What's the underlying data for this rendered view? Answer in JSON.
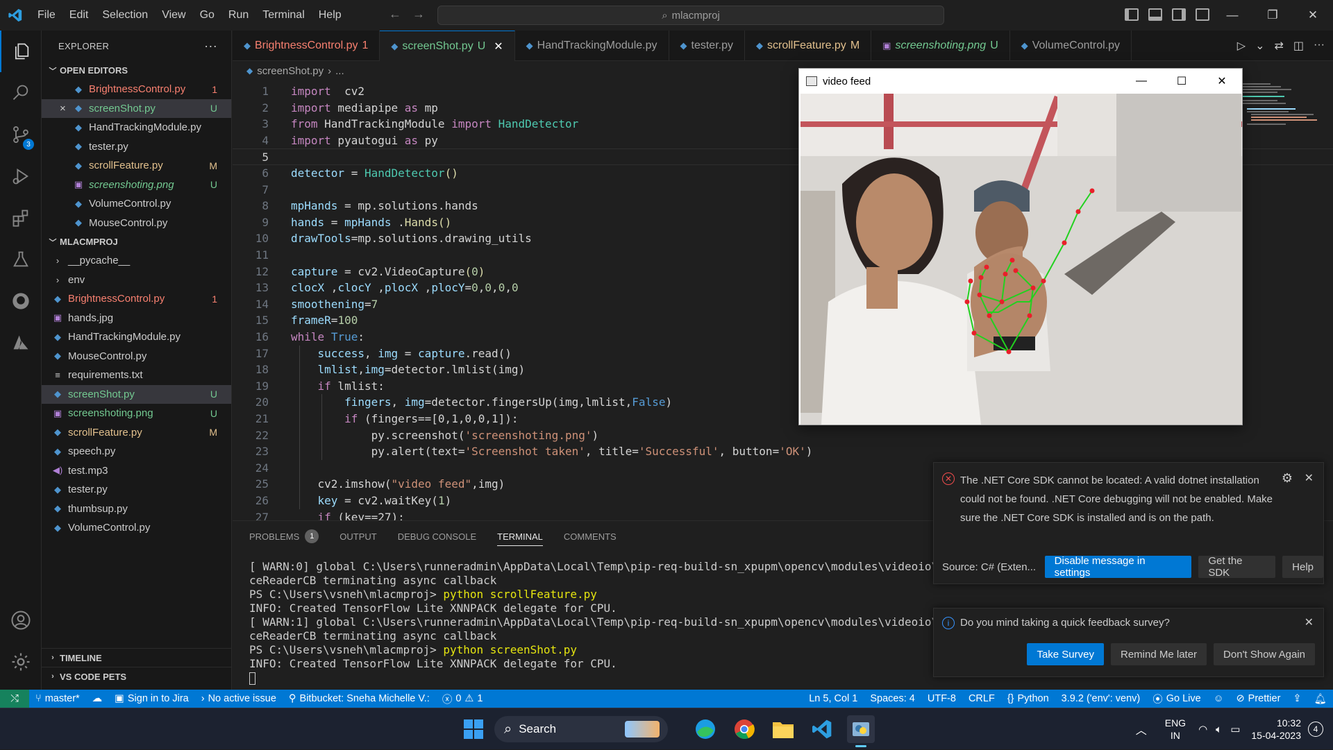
{
  "titlebar": {
    "menu": [
      "File",
      "Edit",
      "Selection",
      "View",
      "Go",
      "Run",
      "Terminal",
      "Help"
    ],
    "search": "mlacmproj"
  },
  "explorer": {
    "title": "EXPLORER",
    "open_editors_label": "OPEN EDITORS",
    "open_editors": [
      {
        "name": "BrightnessControl.py",
        "badge": "1",
        "status": "error",
        "icon": "python-icon"
      },
      {
        "name": "screenShot.py",
        "badge": "U",
        "status": "untracked",
        "icon": "python-icon",
        "selected": true,
        "close": "×"
      },
      {
        "name": "HandTrackingModule.py",
        "badge": "",
        "status": "",
        "icon": "python-icon"
      },
      {
        "name": "tester.py",
        "badge": "",
        "status": "",
        "icon": "python-icon"
      },
      {
        "name": "scrollFeature.py",
        "badge": "M",
        "status": "modified",
        "icon": "python-icon"
      },
      {
        "name": "screenshoting.png",
        "badge": "U",
        "status": "untracked-italic",
        "icon": "image-icon"
      },
      {
        "name": "VolumeControl.py",
        "badge": "",
        "status": "",
        "icon": "python-icon"
      },
      {
        "name": "MouseControl.py",
        "badge": "",
        "status": "",
        "icon": "python-icon"
      }
    ],
    "project_label": "MLACMPROJ",
    "files": [
      {
        "name": "__pycache__",
        "badge": "",
        "status": "",
        "icon": "chevron-right-icon",
        "folder": true
      },
      {
        "name": "env",
        "badge": "",
        "status": "",
        "icon": "chevron-right-icon",
        "folder": true
      },
      {
        "name": "BrightnessControl.py",
        "badge": "1",
        "status": "error",
        "icon": "python-icon"
      },
      {
        "name": "hands.jpg",
        "badge": "",
        "status": "",
        "icon": "image-icon"
      },
      {
        "name": "HandTrackingModule.py",
        "badge": "",
        "status": "",
        "icon": "python-icon"
      },
      {
        "name": "MouseControl.py",
        "badge": "",
        "status": "",
        "icon": "python-icon"
      },
      {
        "name": "requirements.txt",
        "badge": "",
        "status": "",
        "icon": "text-file-icon"
      },
      {
        "name": "screenShot.py",
        "badge": "U",
        "status": "untracked",
        "icon": "python-icon",
        "selected": true
      },
      {
        "name": "screenshoting.png",
        "badge": "U",
        "status": "untracked",
        "icon": "image-icon"
      },
      {
        "name": "scrollFeature.py",
        "badge": "M",
        "status": "modified",
        "icon": "python-icon"
      },
      {
        "name": "speech.py",
        "badge": "",
        "status": "",
        "icon": "python-icon"
      },
      {
        "name": "test.mp3",
        "badge": "",
        "status": "",
        "icon": "audio-icon"
      },
      {
        "name": "tester.py",
        "badge": "",
        "status": "",
        "icon": "python-icon"
      },
      {
        "name": "thumbsup.py",
        "badge": "",
        "status": "",
        "icon": "python-icon"
      },
      {
        "name": "VolumeControl.py",
        "badge": "",
        "status": "",
        "icon": "python-icon"
      }
    ],
    "timeline_label": "TIMELINE",
    "pets_label": "VS CODE PETS"
  },
  "tabs": [
    {
      "label": "BrightnessControl.py",
      "suffix": "1",
      "color": "#f88070"
    },
    {
      "label": "screenShot.py",
      "suffix": "U",
      "color": "#73c991",
      "active": true
    },
    {
      "label": "HandTrackingModule.py",
      "suffix": "",
      "color": ""
    },
    {
      "label": "tester.py",
      "suffix": "",
      "color": ""
    },
    {
      "label": "scrollFeature.py",
      "suffix": "M",
      "color": "#e2c08d"
    },
    {
      "label": "screenshoting.png",
      "suffix": "U",
      "color": "#73c991",
      "italic": true
    },
    {
      "label": "VolumeControl.py",
      "suffix": "",
      "color": ""
    }
  ],
  "breadcrumb": {
    "file": "screenShot.py",
    "rest": "..."
  },
  "editor": {
    "current_line": 5,
    "lines": [
      [
        [
          "kw",
          "import"
        ],
        [
          "",
          "  cv2"
        ]
      ],
      [
        [
          "kw",
          "import"
        ],
        [
          "",
          " mediapipe "
        ],
        [
          "kw",
          "as"
        ],
        [
          "",
          " mp"
        ]
      ],
      [
        [
          "kw",
          "from"
        ],
        [
          "",
          " HandTrackingModule "
        ],
        [
          "kw",
          "import"
        ],
        [
          "",
          " "
        ],
        [
          "cls",
          "HandDetector"
        ]
      ],
      [
        [
          "kw",
          "import"
        ],
        [
          "",
          " pyautogui "
        ],
        [
          "kw",
          "as"
        ],
        [
          "",
          " py"
        ]
      ],
      [],
      [
        [
          "var",
          "detector"
        ],
        [
          "",
          " = "
        ],
        [
          "cls",
          "HandDetector"
        ],
        [
          "fn",
          "()"
        ]
      ],
      [],
      [
        [
          "var",
          "mpHands"
        ],
        [
          "",
          " = mp.solutions.hands"
        ]
      ],
      [
        [
          "var",
          "hands"
        ],
        [
          "",
          " = "
        ],
        [
          "var",
          "mpHands"
        ],
        [
          "",
          " ."
        ],
        [
          "fn",
          "Hands"
        ],
        [
          "fn",
          "()"
        ]
      ],
      [
        [
          "var",
          "drawTools"
        ],
        [
          "",
          "=mp.solutions.drawing_utils"
        ]
      ],
      [],
      [
        [
          "var",
          "capture"
        ],
        [
          "",
          " = cv2.VideoCapture"
        ],
        [
          "fn",
          "("
        ],
        [
          "num",
          "0"
        ],
        [
          "fn",
          ")"
        ]
      ],
      [
        [
          "var",
          "clocX"
        ],
        [
          "",
          " ,"
        ],
        [
          "var",
          "clocY"
        ],
        [
          "",
          " ,"
        ],
        [
          "var",
          "plocX"
        ],
        [
          "",
          " ,"
        ],
        [
          "var",
          "plocY"
        ],
        [
          "",
          "="
        ],
        [
          "num",
          "0"
        ],
        [
          "",
          ","
        ],
        [
          "num",
          "0"
        ],
        [
          "",
          ","
        ],
        [
          "num",
          "0"
        ],
        [
          "",
          ","
        ],
        [
          "num",
          "0"
        ]
      ],
      [
        [
          "var",
          "smoothening"
        ],
        [
          "",
          "="
        ],
        [
          "num",
          "7"
        ]
      ],
      [
        [
          "var",
          "frameR"
        ],
        [
          "",
          "="
        ],
        [
          "num",
          "100"
        ]
      ],
      [
        [
          "kw",
          "while"
        ],
        [
          "",
          " "
        ],
        [
          "bl",
          "True"
        ],
        [
          "",
          ":"
        ]
      ],
      [
        [
          "",
          "    "
        ],
        [
          "var",
          "success"
        ],
        [
          "",
          ", "
        ],
        [
          "var",
          "img"
        ],
        [
          "",
          " = "
        ],
        [
          "var",
          "capture"
        ],
        [
          "",
          ".read()"
        ]
      ],
      [
        [
          "",
          "    "
        ],
        [
          "var",
          "lmlist"
        ],
        [
          "",
          ","
        ],
        [
          "var",
          "img"
        ],
        [
          "",
          "=detector.lmlist(img)"
        ]
      ],
      [
        [
          "",
          "    "
        ],
        [
          "kw",
          "if"
        ],
        [
          "",
          " lmlist:"
        ]
      ],
      [
        [
          "",
          "        "
        ],
        [
          "var",
          "fingers"
        ],
        [
          "",
          ", "
        ],
        [
          "var",
          "img"
        ],
        [
          "",
          "=detector.fingersUp(img,lmlist,"
        ],
        [
          "bl",
          "False"
        ],
        [
          "",
          ")"
        ]
      ],
      [
        [
          "",
          "        "
        ],
        [
          "kw",
          "if"
        ],
        [
          "",
          " (fingers==[0,1,0,0,1]):"
        ]
      ],
      [
        [
          "",
          "            py.screenshot("
        ],
        [
          "str",
          "'screenshoting.png'"
        ],
        [
          "",
          ")"
        ]
      ],
      [
        [
          "",
          "            py.alert(text="
        ],
        [
          "str",
          "'Screenshot taken'"
        ],
        [
          "",
          ", title="
        ],
        [
          "str",
          "'Successful'"
        ],
        [
          "",
          ", button="
        ],
        [
          "str",
          "'OK'"
        ],
        [
          "",
          ")"
        ]
      ],
      [],
      [
        [
          "",
          "    cv2.imshow("
        ],
        [
          "str",
          "\"video feed\""
        ],
        [
          "",
          ",img)"
        ]
      ],
      [
        [
          "",
          "    "
        ],
        [
          "var",
          "key"
        ],
        [
          "",
          " = cv2.waitKey("
        ],
        [
          "num",
          "1"
        ],
        [
          "",
          ")"
        ]
      ],
      [
        [
          "",
          "    "
        ],
        [
          "kw",
          "if"
        ],
        [
          "",
          " (key==27):"
        ]
      ]
    ]
  },
  "video_window": {
    "title": "video feed"
  },
  "panel": {
    "tabs": [
      "PROBLEMS",
      "OUTPUT",
      "DEBUG CONSOLE",
      "TERMINAL",
      "COMMENTS"
    ],
    "problems_count": "1",
    "active_tab": "TERMINAL",
    "terminal_lines": [
      {
        "text": "[ WARN:0] global C:\\Users\\runneradmin\\AppData\\Local\\Temp\\pip-req-build-sn_xpupm\\opencv\\modules\\videoio\\src\\cap",
        "cmd": ""
      },
      {
        "text": "ceReaderCB terminating async callback",
        "cmd": ""
      },
      {
        "text": "PS C:\\Users\\vsneh\\mlacmproj> ",
        "cmd": "python scrollFeature.py"
      },
      {
        "text": "INFO: Created TensorFlow Lite XNNPACK delegate for CPU.",
        "cmd": ""
      },
      {
        "text": "[ WARN:1] global C:\\Users\\runneradmin\\AppData\\Local\\Temp\\pip-req-build-sn_xpupm\\opencv\\modules\\videoio\\src\\cap",
        "cmd": ""
      },
      {
        "text": "ceReaderCB terminating async callback",
        "cmd": ""
      },
      {
        "text": "PS C:\\Users\\vsneh\\mlacmproj> ",
        "cmd": "python screenShot.py"
      },
      {
        "text": "INFO: Created TensorFlow Lite XNNPACK delegate for CPU.",
        "cmd": ""
      }
    ]
  },
  "notifications": {
    "sdk": {
      "message": "The .NET Core SDK cannot be located: A valid dotnet installation could not be found. .NET Core debugging will not be enabled. Make sure the .NET Core SDK is installed and is on the path.",
      "source": "Source: C# (Exten...",
      "buttons": [
        "Disable message in settings",
        "Get the SDK",
        "Help"
      ]
    },
    "survey": {
      "message": "Do you mind taking a quick feedback survey?",
      "buttons": [
        "Take Survey",
        "Remind Me later",
        "Don't Show Again"
      ]
    }
  },
  "statusbar": {
    "branch": "master*",
    "jira": "Sign in to Jira",
    "issue": "No active issue",
    "bitbucket": "Bitbucket: Sneha Michelle V.:",
    "errors": "0",
    "warnings": "1",
    "position": "Ln 5, Col 1",
    "spaces": "Spaces: 4",
    "encoding": "UTF-8",
    "eol": "CRLF",
    "language": "Python",
    "interpreter": "3.9.2 ('env': venv)",
    "golive": "Go Live",
    "prettier": "Prettier"
  },
  "taskbar": {
    "search": "Search",
    "lang1": "ENG",
    "lang2": "IN",
    "time": "10:32",
    "date": "15-04-2023",
    "notif_count": "4"
  }
}
